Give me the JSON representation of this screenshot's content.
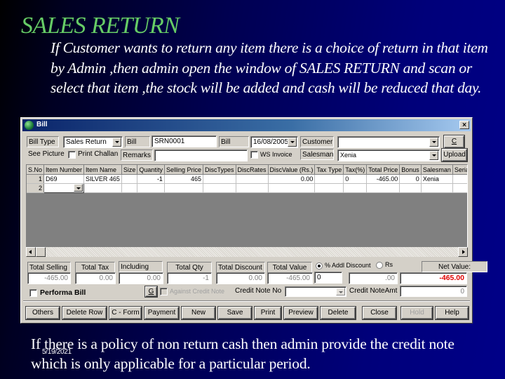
{
  "slide": {
    "title": "SALES RETURN",
    "intro": "If Customer wants to return any item  there is a choice of return in that item by Admin ,then admin open the window of SALES RETURN and scan or select that item ,the stock will be added and cash will be reduced that day.",
    "footer": "If there is a policy of non return cash then admin provide the credit note which is only applicable for a particular period.",
    "date": "5/19/2021",
    "colors": {
      "title": "#66cc66",
      "text": "#ffffff",
      "background": "#000080"
    }
  },
  "window": {
    "title": "Bill",
    "close_icon": "×",
    "header": {
      "bill_type_label": "Bill Type",
      "bill_type_value": "Sales Return",
      "bill_no_label": "Bill No.",
      "bill_no_value": "SRN0001",
      "bill_date_label": "Bill Date",
      "bill_date_value": "16/08/2005",
      "customer_label": "Customer",
      "customer_value": "",
      "c_button": "C",
      "see_picture_label": "See Picture",
      "print_challan_label": "Print Challan",
      "print_challan_checked": false,
      "remarks_label": "Remarks",
      "remarks_value": "",
      "ws_invoice_label": "WS Invoice",
      "ws_invoice_checked": false,
      "salesman_label": "Salesman",
      "salesman_value": "Xenia",
      "upload_button": "Upload"
    },
    "grid": {
      "columns": [
        "S.No",
        "Item Number",
        "Item Name",
        "Size",
        "Quantity",
        "Selling Price",
        "DiscTypes",
        "DiscRates",
        "DiscValue (Rs.)",
        "Tax Type",
        "Tax(%)",
        "Total Price",
        "Bonus",
        "Salesman",
        "Serial No"
      ],
      "rows": [
        [
          "1",
          "D69",
          "SILVER 465",
          "",
          "-1",
          "465",
          "",
          "",
          "0.00",
          "",
          "0",
          "-465.00",
          "0",
          "Xenia",
          ""
        ],
        [
          "2",
          "",
          "",
          "",
          "",
          "",
          "",
          "",
          "",
          "",
          "",
          "",
          "",
          "",
          ""
        ]
      ]
    },
    "totals": {
      "total_selling_label": "Total Selling",
      "total_selling_value": "-465.00",
      "total_tax_label": "Total Tax",
      "total_tax_value": "0.00",
      "including_tax_label": "Including Tax",
      "including_tax_value": "0.00",
      "total_qty_label": "Total Qty",
      "total_qty_value": "-1",
      "total_discount_label": "Total Discount",
      "total_discount_value": "0.00",
      "total_value_label": "Total Value",
      "total_value_value": "-465.00",
      "addl_discount_pct_label": "% Addl Discount",
      "addl_discount_pct_selected": true,
      "addl_discount_rs_label": "Rs",
      "addl_discount_input": "0",
      "addl_discount_amount": ".00",
      "net_value_label": "Net Value:",
      "net_value": "-465.00",
      "net_value_color": "#e00000"
    },
    "credit": {
      "performa_bill_label": "Performa Bill",
      "performa_bill_checked": false,
      "g_button": "G",
      "against_credit_note_label": "Against Credit Note",
      "credit_note_no_label": "Credit Note No",
      "credit_note_no_value": "",
      "credit_note_amt_label": "Credit NoteAmt",
      "credit_note_amt_value": "0"
    },
    "buttons": [
      {
        "label": "Others",
        "enabled": true
      },
      {
        "label": "Delete Row",
        "enabled": true
      },
      {
        "label": "C - Form",
        "enabled": true
      },
      {
        "label": "Payment",
        "enabled": true
      },
      {
        "label": "New",
        "enabled": true
      },
      {
        "label": "Save",
        "enabled": true
      },
      {
        "label": "Print",
        "enabled": true
      },
      {
        "label": "Preview",
        "enabled": true
      },
      {
        "label": "Delete",
        "enabled": true
      },
      {
        "label": "Close",
        "enabled": true
      },
      {
        "label": "Hold",
        "enabled": false
      },
      {
        "label": "Help",
        "enabled": true
      }
    ]
  }
}
